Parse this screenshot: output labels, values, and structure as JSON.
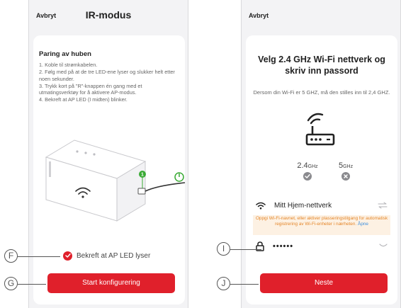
{
  "left_screen": {
    "cancel_label": "Avbryt",
    "title": "IR-modus",
    "section_title": "Paring av huben",
    "steps": [
      "1. Koble til strømkabelen.",
      "2. Følg med på at de tre LED-ene lyser og slukker helt etter noen sekunder.",
      "3. Trykk kort på \"R\"-knappen én gang med et utmatingsverktøy for å aktivere AP-modus.",
      "4. Bekreft at AP LED (I midten) blinker."
    ],
    "illustration_number": "1",
    "confirm_label": "Bekreft at AP LED lyser",
    "confirm_checked": true,
    "start_button": "Start konfigurering"
  },
  "right_screen": {
    "cancel_label": "Avbryt",
    "heading": "Velg 2.4 GHz Wi-Fi nettverk og skriv inn passord",
    "subtext": "Dersom din Wi-Fi er 5 GHZ, må den stilles inn til 2,4 GHZ.",
    "bands": [
      {
        "label": "2.4",
        "unit": "GHz",
        "status": "check"
      },
      {
        "label": "5",
        "unit": "GHz",
        "status": "cross"
      }
    ],
    "network_name": "Mitt Hjem-nettverk",
    "warning_text": "Oppgi Wi-Fi-navnet, eller aktiver plasseringstilgang for automatisk registrering av Wi-Fi-enheter i nærheten.",
    "warning_link": "Åpne",
    "password_mask": "••••••",
    "next_button": "Neste"
  },
  "callouts": {
    "f": "F",
    "g": "G",
    "i": "I",
    "j": "J"
  },
  "colors": {
    "accent": "#e0202b",
    "background": "#f3f3f5",
    "warning_bg": "#fdf1e3",
    "warning_text": "#e4862a",
    "link": "#3a8dde",
    "led_green": "#3aaa35"
  }
}
